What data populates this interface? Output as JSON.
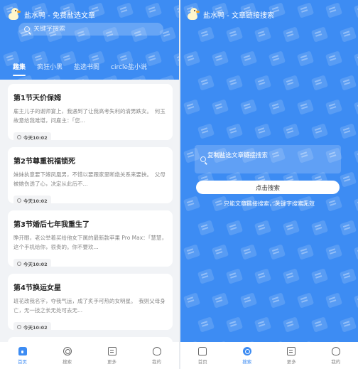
{
  "colors": {
    "brand_blue": "#3d8cf3",
    "background": "#f1f3f6",
    "card": "#ffffff"
  },
  "left": {
    "title": "盐水鸭 - 免费盐选文章",
    "search": {
      "placeholder": "关键字搜索"
    },
    "tabs": [
      {
        "label": "趣集",
        "active": true
      },
      {
        "label": "疯狂小黑",
        "active": false
      },
      {
        "label": "盐选书阁",
        "active": false
      },
      {
        "label": "circle盐小说",
        "active": false
      }
    ],
    "articles": [
      {
        "title": "第1节天价保姆",
        "excerpt": "雇主儿子的谢师宴上，我遇到了让我高考失利的清男跌女。　何玉故意给我难堪，问雇主：「您...",
        "time": "今天10:02"
      },
      {
        "title": "第2节尊重祝福锁死",
        "excerpt": "妹妹执意要下嫁凤凰男，不惜以要跟家里断绝关系来要挟。　父母被她伤透了心，决定从此后不...",
        "time": "今天10:02"
      },
      {
        "title": "第3节婚后七年我重生了",
        "excerpt": "睁开眼，老公举着买给他女下属的最新款苹果 Pro Max：「慧慧，这个手机给你，很贵的。你不要欢...",
        "time": "今天10:02"
      },
      {
        "title": "第4节换运女星",
        "excerpt": "班花改我名字，夺我气运，成了炙手可热的女明星。　我则父母身亡，无一技之长无处可去无...",
        "time": "今天10:02"
      }
    ],
    "nav": [
      {
        "label": "首页",
        "icon": "home-icon",
        "active": true
      },
      {
        "label": "搜索",
        "icon": "search-icon",
        "active": false
      },
      {
        "label": "更多",
        "icon": "more-icon",
        "active": false
      },
      {
        "label": "我的",
        "icon": "mine-icon",
        "active": false
      }
    ]
  },
  "right": {
    "title": "盐水鸭 - 文章链接搜索",
    "link_input": {
      "placeholder": "复制盐选文章链接搜索"
    },
    "search_button": "点击搜索",
    "hint": "只能文章链接搜索，关键字搜索无效",
    "nav": [
      {
        "label": "首页",
        "icon": "home-icon",
        "active": false
      },
      {
        "label": "搜索",
        "icon": "search-icon",
        "active": true
      },
      {
        "label": "更多",
        "icon": "more-icon",
        "active": false
      },
      {
        "label": "我的",
        "icon": "mine-icon",
        "active": false
      }
    ]
  }
}
